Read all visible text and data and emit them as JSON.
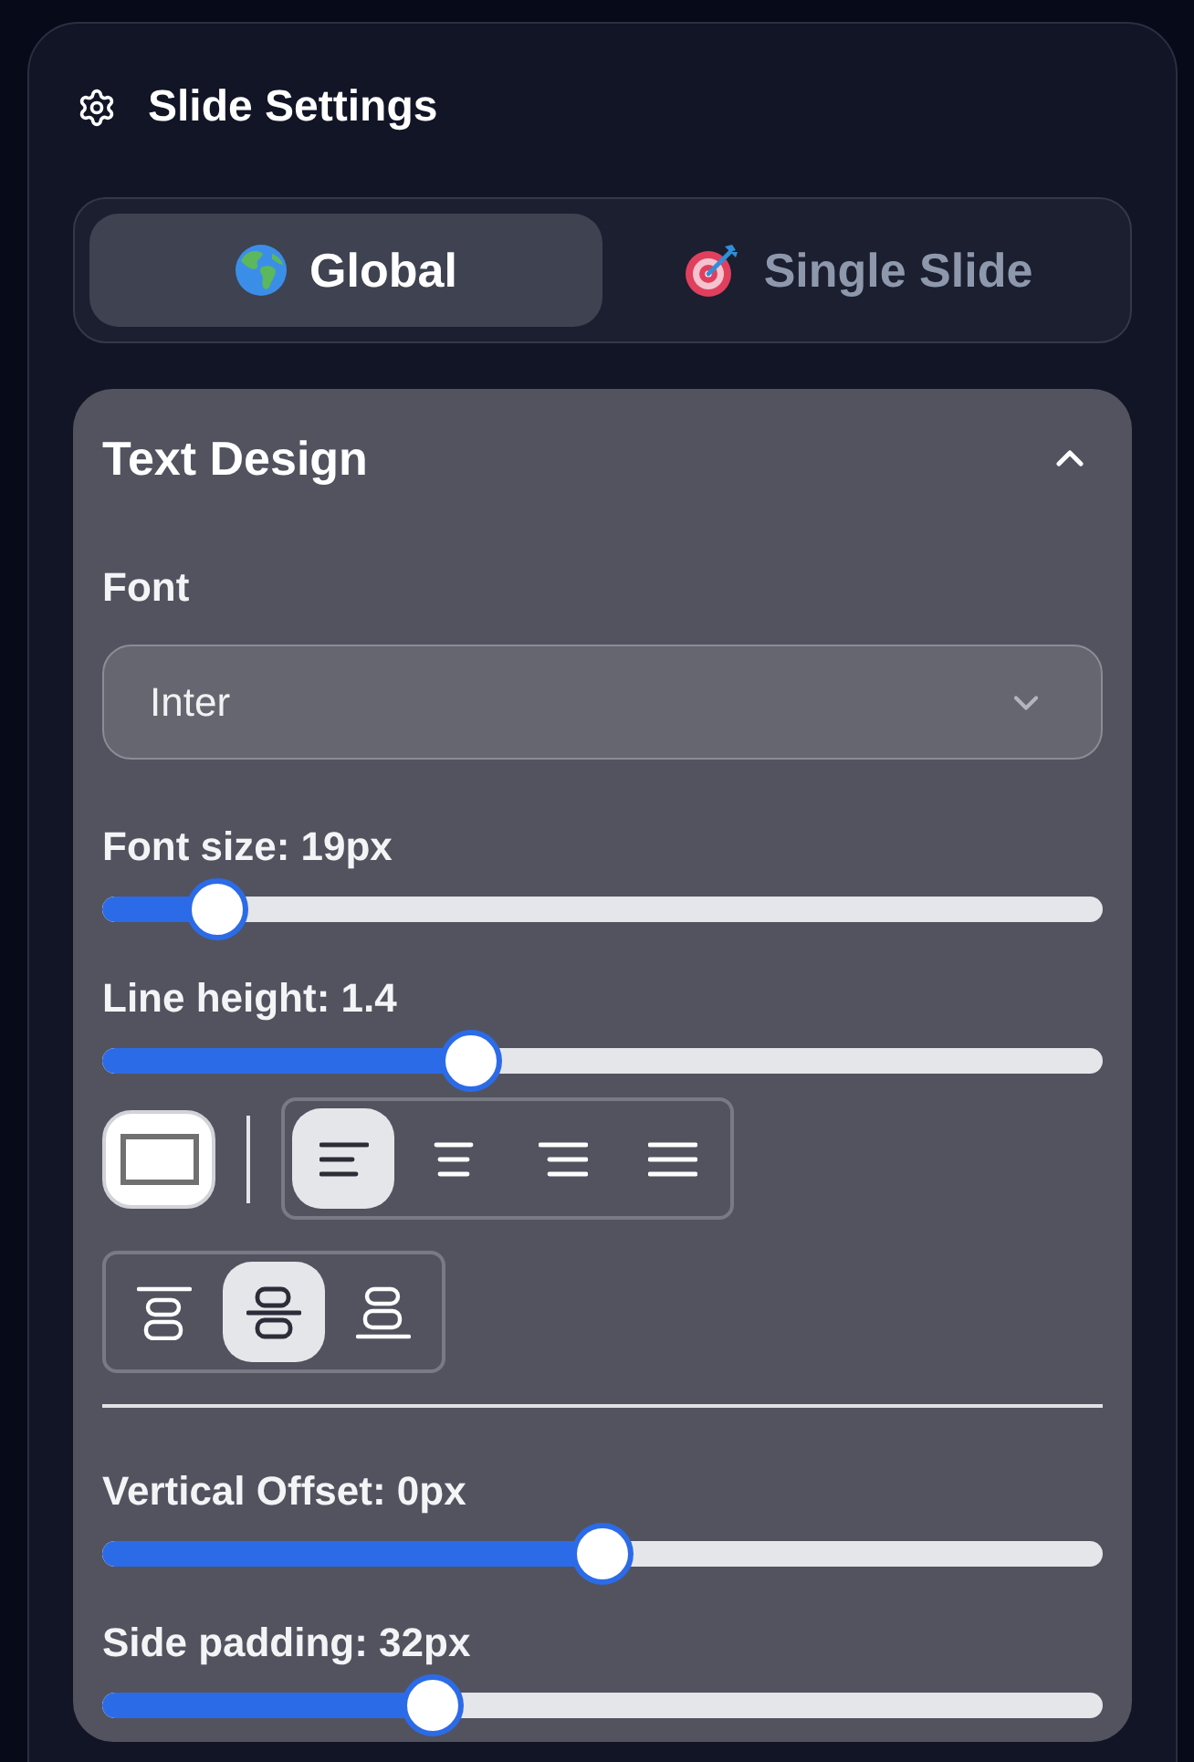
{
  "panel": {
    "title": "Slide Settings"
  },
  "scope_tabs": [
    {
      "label": "Global",
      "selected": true
    },
    {
      "label": "Single Slide",
      "selected": false
    }
  ],
  "text_design": {
    "title": "Text Design",
    "expanded": true,
    "font": {
      "label": "Font",
      "value": "Inter"
    },
    "upper_sliders": [
      {
        "label": "Font size: 19px",
        "level": 0.09
      },
      {
        "label": "Line height: 1.4",
        "level": 0.36
      }
    ],
    "text_align": [
      {
        "kind": "left",
        "selected": true
      },
      {
        "kind": "center",
        "selected": false
      },
      {
        "kind": "right",
        "selected": false
      },
      {
        "kind": "justify",
        "selected": false
      }
    ],
    "vertical_align": [
      {
        "kind": "top",
        "selected": false
      },
      {
        "kind": "middle",
        "selected": true
      },
      {
        "kind": "bottom",
        "selected": false
      }
    ],
    "lower_sliders": [
      {
        "label": "Vertical Offset: 0px",
        "level": 0.5
      },
      {
        "label": "Side padding: 32px",
        "level": 0.32
      }
    ]
  }
}
